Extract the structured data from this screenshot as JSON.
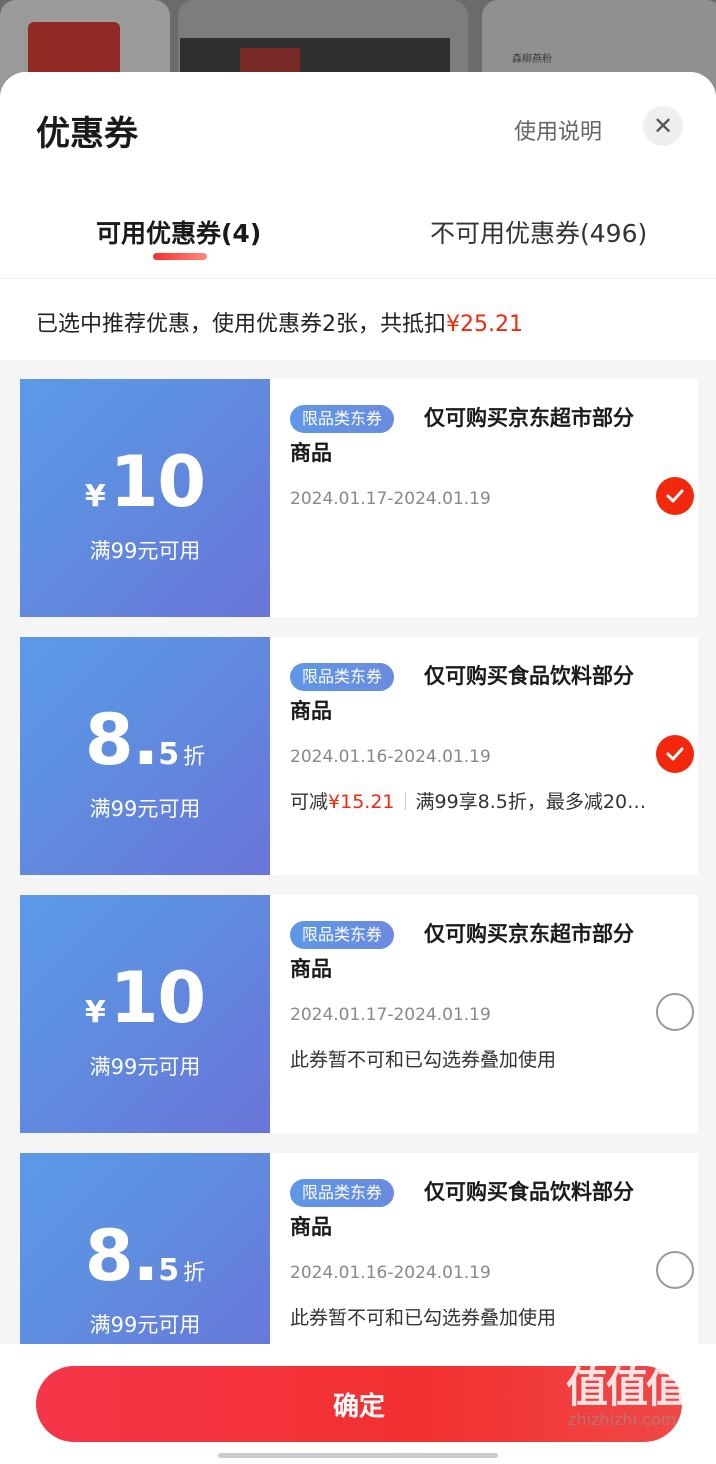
{
  "background": {
    "bg_text": "森柳燕粉"
  },
  "header": {
    "title": "优惠券",
    "help_label": "使用说明",
    "close_icon": "close-icon"
  },
  "tabs": [
    {
      "label": "可用优惠券(4)",
      "active": true
    },
    {
      "label": "不可用优惠券(496)",
      "active": false
    }
  ],
  "summary": {
    "text": "已选中推荐优惠，使用优惠券2张，共抵扣",
    "amount": "¥25.21"
  },
  "coupons": [
    {
      "symbol": "¥",
      "value": "10",
      "small": "",
      "unit": "",
      "condition": "满99元可用",
      "tag": "限品类东券",
      "desc": "仅可购买京东超市部分商品",
      "dates": "2024.01.17-2024.01.19",
      "note": "",
      "selected": true
    },
    {
      "symbol": "",
      "value": "8.",
      "small": "5",
      "unit": "折",
      "condition": "满99元可用",
      "tag": "限品类东券",
      "desc": "仅可购买食品饮料部分商品",
      "dates": "2024.01.16-2024.01.19",
      "note_prefix": "可减",
      "note_amount": "¥15.21",
      "note_rest": "满99享8.5折，最多减20…",
      "selected": true
    },
    {
      "symbol": "¥",
      "value": "10",
      "small": "",
      "unit": "",
      "condition": "满99元可用",
      "tag": "限品类东券",
      "desc": "仅可购买京东超市部分商品",
      "dates": "2024.01.17-2024.01.19",
      "note": "此券暂不可和已勾选券叠加使用",
      "selected": false
    },
    {
      "symbol": "",
      "value": "8.",
      "small": "5",
      "unit": "折",
      "condition": "满99元可用",
      "tag": "限品类东券",
      "desc": "仅可购买食品饮料部分商品",
      "dates": "2024.01.16-2024.01.19",
      "note": "此券暂不可和已勾选券叠加使用",
      "selected": false
    }
  ],
  "footer": {
    "confirm_label": "确定",
    "watermark": "值值值",
    "watermark_url": "zhizhizhi.com"
  }
}
